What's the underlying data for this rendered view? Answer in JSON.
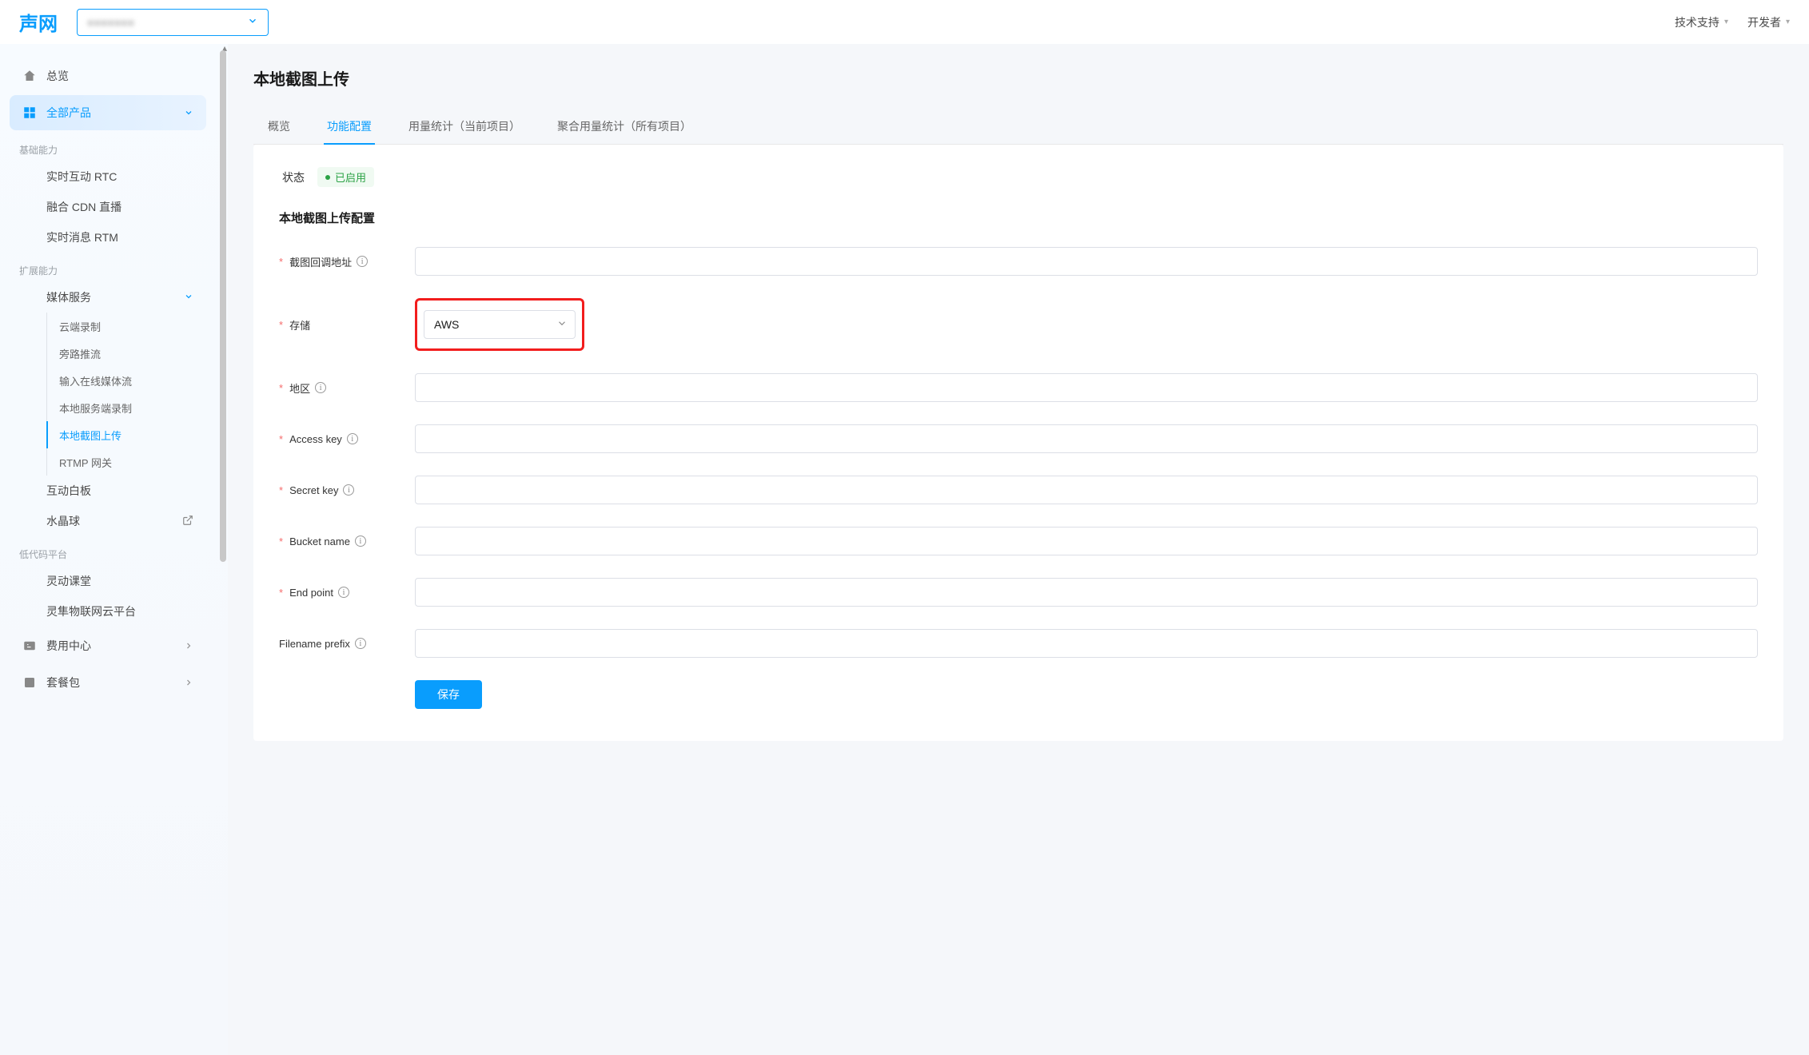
{
  "topbar": {
    "logo": "声网",
    "project_placeholder": "■■■■■■■",
    "tech_support": "技术支持",
    "developer": "开发者"
  },
  "sidebar": {
    "overview": "总览",
    "all_products": "全部产品",
    "section_basic": "基础能力",
    "items_basic": [
      "实时互动 RTC",
      "融合 CDN 直播",
      "实时消息 RTM"
    ],
    "section_ext": "扩展能力",
    "media_services": "媒体服务",
    "media_items": [
      "云端录制",
      "旁路推流",
      "输入在线媒体流",
      "本地服务端录制",
      "本地截图上传",
      "RTMP 网关"
    ],
    "whiteboard": "互动白板",
    "crystal_ball": "水晶球",
    "section_lowcode": "低代码平台",
    "lowcode_items": [
      "灵动课堂",
      "灵隼物联网云平台"
    ],
    "billing": "费用中心",
    "package": "套餐包"
  },
  "page": {
    "title": "本地截图上传",
    "tabs": [
      "概览",
      "功能配置",
      "用量统计（当前项目）",
      "聚合用量统计（所有项目）"
    ],
    "status_label": "状态",
    "status_value": "已启用",
    "config_title": "本地截图上传配置",
    "fields": {
      "callback": "截图回调地址",
      "storage": "存储",
      "storage_value": "AWS",
      "region": "地区",
      "access_key": "Access key",
      "secret_key": "Secret key",
      "bucket_name": "Bucket name",
      "end_point": "End point",
      "filename_prefix": "Filename prefix"
    },
    "save_btn": "保存"
  }
}
